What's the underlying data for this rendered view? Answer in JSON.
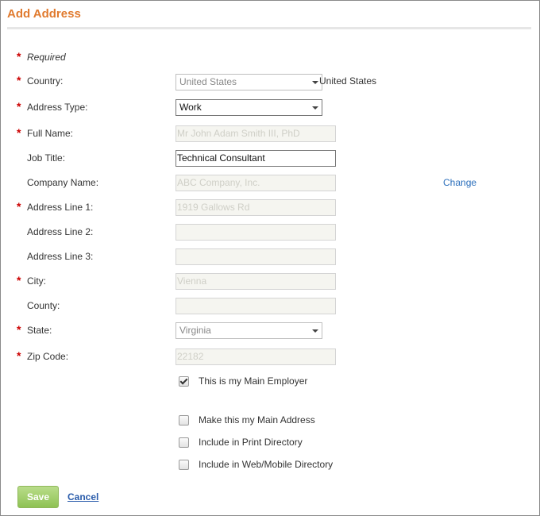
{
  "header": {
    "title": "Add Address"
  },
  "form": {
    "required_note": "Required",
    "required_star": "*",
    "country": {
      "label": "Country:",
      "value": "United States",
      "display_text": "United States"
    },
    "address_type": {
      "label": "Address Type:",
      "value": "Work"
    },
    "full_name": {
      "label": "Full Name:",
      "value": "Mr John Adam Smith III, PhD"
    },
    "job_title": {
      "label": "Job Title:",
      "value": "Technical Consultant"
    },
    "company_name": {
      "label": "Company Name:",
      "value": "ABC Company, Inc.",
      "change_label": "Change"
    },
    "address_line_1": {
      "label": "Address Line 1:",
      "value": "1919 Gallows Rd"
    },
    "address_line_2": {
      "label": "Address Line 2:",
      "value": ""
    },
    "address_line_3": {
      "label": "Address Line 3:",
      "value": ""
    },
    "city": {
      "label": "City:",
      "value": "Vienna"
    },
    "county": {
      "label": "County:",
      "value": ""
    },
    "state": {
      "label": "State:",
      "value": "Virginia"
    },
    "zip_code": {
      "label": "Zip Code:",
      "value": "22182"
    }
  },
  "checkboxes": {
    "main_employer": {
      "label": "This is my Main Employer",
      "checked": true
    },
    "main_address": {
      "label": "Make this my Main Address",
      "checked": false
    },
    "print_directory": {
      "label": "Include in Print Directory",
      "checked": false
    },
    "web_mobile_directory": {
      "label": "Include in Web/Mobile Directory",
      "checked": false
    }
  },
  "actions": {
    "save_label": "Save",
    "cancel_label": "Cancel"
  },
  "colors": {
    "title": "#e07a2e",
    "required": "#cc0000",
    "link": "#2a6ebb",
    "save_button": "#9ccb66"
  }
}
